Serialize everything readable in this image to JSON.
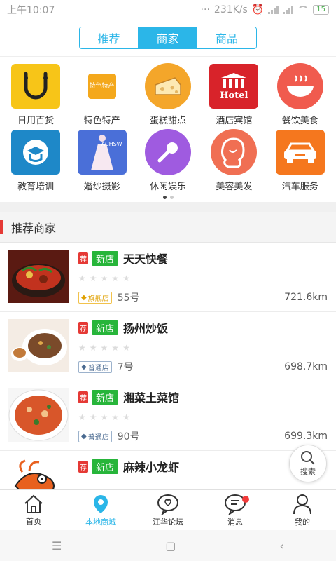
{
  "status": {
    "time": "上午10:07",
    "speed": "231K/s",
    "battery": "15"
  },
  "tabs": [
    {
      "label": "推荐"
    },
    {
      "label": "商家"
    },
    {
      "label": "商品"
    }
  ],
  "categories_row1": [
    {
      "label": "日用百货",
      "icon": "smile-bag-icon"
    },
    {
      "label": "特色特产",
      "icon": "specialty-icon",
      "icon_text": "特色特产"
    },
    {
      "label": "蛋糕甜点",
      "icon": "cake-icon"
    },
    {
      "label": "酒店宾馆",
      "icon": "hotel-icon",
      "icon_text": "Hotel"
    },
    {
      "label": "餐饮美食",
      "icon": "bowl-icon"
    }
  ],
  "categories_row2": [
    {
      "label": "教育培训",
      "icon": "education-icon"
    },
    {
      "label": "婚纱摄影",
      "icon": "wedding-icon",
      "icon_text": "ACHSW"
    },
    {
      "label": "休闲娱乐",
      "icon": "microphone-icon"
    },
    {
      "label": "美容美发",
      "icon": "beauty-icon"
    },
    {
      "label": "汽车服务",
      "icon": "car-icon"
    }
  ],
  "section": {
    "title": "推荐商家"
  },
  "merchants": [
    {
      "tag_recommend": "荐",
      "tag_new": "新店",
      "name": "天天快餐",
      "level": "旗舰店",
      "number": "55号",
      "distance": "721.6km",
      "rating": 0
    },
    {
      "tag_recommend": "荐",
      "tag_new": "新店",
      "name": "扬州炒饭",
      "level": "普通店",
      "number": "7号",
      "distance": "698.7km",
      "rating": 0
    },
    {
      "tag_recommend": "荐",
      "tag_new": "新店",
      "name": "湘菜土菜馆",
      "level": "普通店",
      "number": "90号",
      "distance": "699.3km",
      "rating": 0
    },
    {
      "tag_recommend": "荐",
      "tag_new": "新店",
      "name": "麻辣小龙虾",
      "level": "",
      "number": "",
      "distance": "",
      "rating": 0
    }
  ],
  "search_fab": {
    "label": "搜索"
  },
  "bottom_nav": [
    {
      "label": "首页",
      "icon": "home-icon"
    },
    {
      "label": "本地商城",
      "icon": "location-icon"
    },
    {
      "label": "江华论坛",
      "icon": "forum-icon"
    },
    {
      "label": "消息",
      "icon": "message-icon"
    },
    {
      "label": "我的",
      "icon": "user-icon"
    }
  ],
  "colors": {
    "accent": "#2bb6e8",
    "red": "#e53935",
    "green": "#27b53a"
  }
}
